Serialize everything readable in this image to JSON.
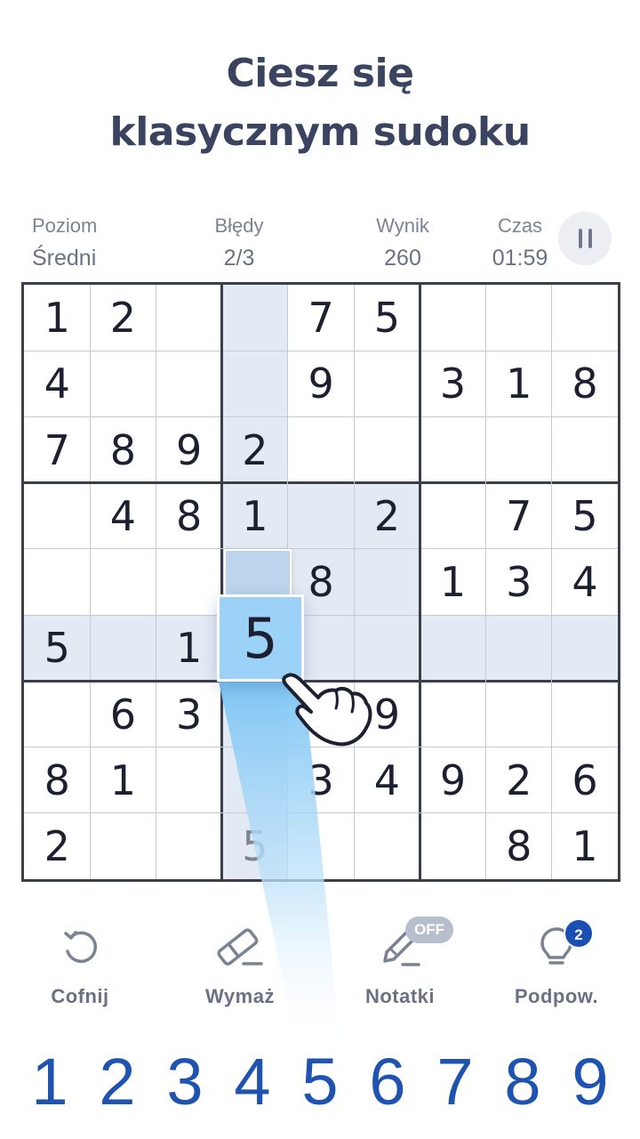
{
  "headline": {
    "line1": "Ciesz się",
    "line2": "klasycznym sudoku"
  },
  "stats": {
    "level": {
      "label": "Poziom",
      "value": "Średni"
    },
    "mistakes": {
      "label": "Błędy",
      "value": "2/3"
    },
    "score": {
      "label": "Wynik",
      "value": "260"
    },
    "time": {
      "label": "Czas",
      "value": "01:59"
    }
  },
  "board": {
    "rows": [
      [
        "1",
        "2",
        "",
        "",
        "7",
        "5",
        "",
        "",
        ""
      ],
      [
        "4",
        "",
        "",
        "",
        "9",
        "",
        "3",
        "1",
        "8"
      ],
      [
        "7",
        "8",
        "9",
        "2",
        "",
        "",
        "",
        "",
        ""
      ],
      [
        "",
        "4",
        "8",
        "1",
        "",
        "2",
        "",
        "7",
        "5"
      ],
      [
        "",
        "",
        "",
        "",
        "8",
        "",
        "1",
        "3",
        "4"
      ],
      [
        "5",
        "",
        "1",
        "5",
        "",
        "",
        "",
        "",
        ""
      ],
      [
        "",
        "6",
        "3",
        "",
        "",
        "9",
        "",
        "",
        ""
      ],
      [
        "8",
        "1",
        "",
        "",
        "3",
        "4",
        "9",
        "2",
        "6"
      ],
      [
        "2",
        "",
        "",
        "5",
        "",
        "",
        "",
        "8",
        "1"
      ]
    ],
    "selected_cell": {
      "row": 5,
      "col": 3,
      "value": "5"
    }
  },
  "tools": {
    "undo": {
      "label": "Cofnij",
      "icon": "undo-icon"
    },
    "erase": {
      "label": "Wymaż",
      "icon": "eraser-icon"
    },
    "notes": {
      "label": "Notatki",
      "icon": "pencil-icon",
      "badge": "OFF"
    },
    "hint": {
      "label": "Podpow.",
      "icon": "lightbulb-icon",
      "badge": "2"
    }
  },
  "numpad": [
    "1",
    "2",
    "3",
    "4",
    "5",
    "6",
    "7",
    "8",
    "9"
  ],
  "colors": {
    "accent": "#1e53b0",
    "highlight": "#e3eaf3",
    "selected": "#9cd2f7",
    "grid_thick": "#3b3f4c",
    "badge_blue": "#1a4fb4"
  }
}
